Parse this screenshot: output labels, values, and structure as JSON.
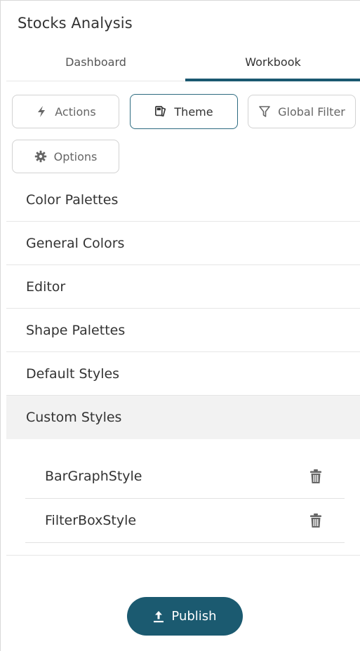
{
  "header": {
    "title": "Stocks Analysis"
  },
  "tabs": [
    {
      "label": "Dashboard",
      "active": false
    },
    {
      "label": "Workbook",
      "active": true
    }
  ],
  "toolbar": {
    "actions_label": "Actions",
    "theme_label": "Theme",
    "global_filter_label": "Global Filter",
    "options_label": "Options"
  },
  "sections": [
    {
      "label": "Color Palettes"
    },
    {
      "label": "General Colors"
    },
    {
      "label": "Editor"
    },
    {
      "label": "Shape Palettes"
    },
    {
      "label": "Default Styles"
    },
    {
      "label": "Custom Styles",
      "selected": true
    }
  ],
  "custom_styles": [
    {
      "name": "BarGraphStyle"
    },
    {
      "name": "FilterBoxStyle"
    }
  ],
  "footer": {
    "publish_label": "Publish"
  },
  "colors": {
    "accent": "#1b5a70",
    "selected_bg": "#f2f2f2",
    "border": "#d2d2d2"
  },
  "icons": {
    "actions": "lightning-icon",
    "theme": "theme-icon",
    "global_filter": "filter-icon",
    "options": "gear-icon",
    "delete": "trash-icon",
    "publish": "upload-icon"
  }
}
